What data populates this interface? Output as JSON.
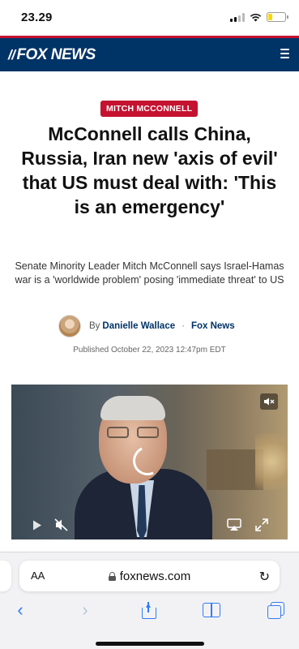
{
  "status_bar": {
    "time": "23.29",
    "battery_level": 0.25
  },
  "site": {
    "logo_text": "FOX NEWS",
    "logo_icon": "fox-news-logo-icon",
    "menu_icon": "hamburger-menu-icon",
    "brand_color": "#003366",
    "accent_color": "#c41230"
  },
  "article": {
    "category": "MITCH MCCONNELL",
    "headline": "McConnell calls China, Russia, Iran new 'axis of evil' that US must deal with: 'This is an emergency'",
    "subhead": "Senate Minority Leader Mitch McConnell says Israel-Hamas war is a 'worldwide problem' posing 'immediate threat' to US",
    "byline": {
      "by": "By",
      "author": "Danielle Wallace",
      "separator": "·",
      "source": "Fox News"
    },
    "published": "Published October 22, 2023 12:47pm EDT"
  },
  "video": {
    "mute_badge": "🔇×",
    "controls": {
      "play_icon": "play-icon",
      "mute_icon": "muted-speaker-icon",
      "airplay_icon": "airplay-icon",
      "fullscreen_icon": "fullscreen-icon"
    }
  },
  "browser": {
    "aa_label": "AA",
    "url": "foxnews.com",
    "reload_glyph": "↻",
    "nav": {
      "back_glyph": "‹",
      "forward_glyph": "›"
    },
    "accent_color": "#2f7cf6"
  }
}
